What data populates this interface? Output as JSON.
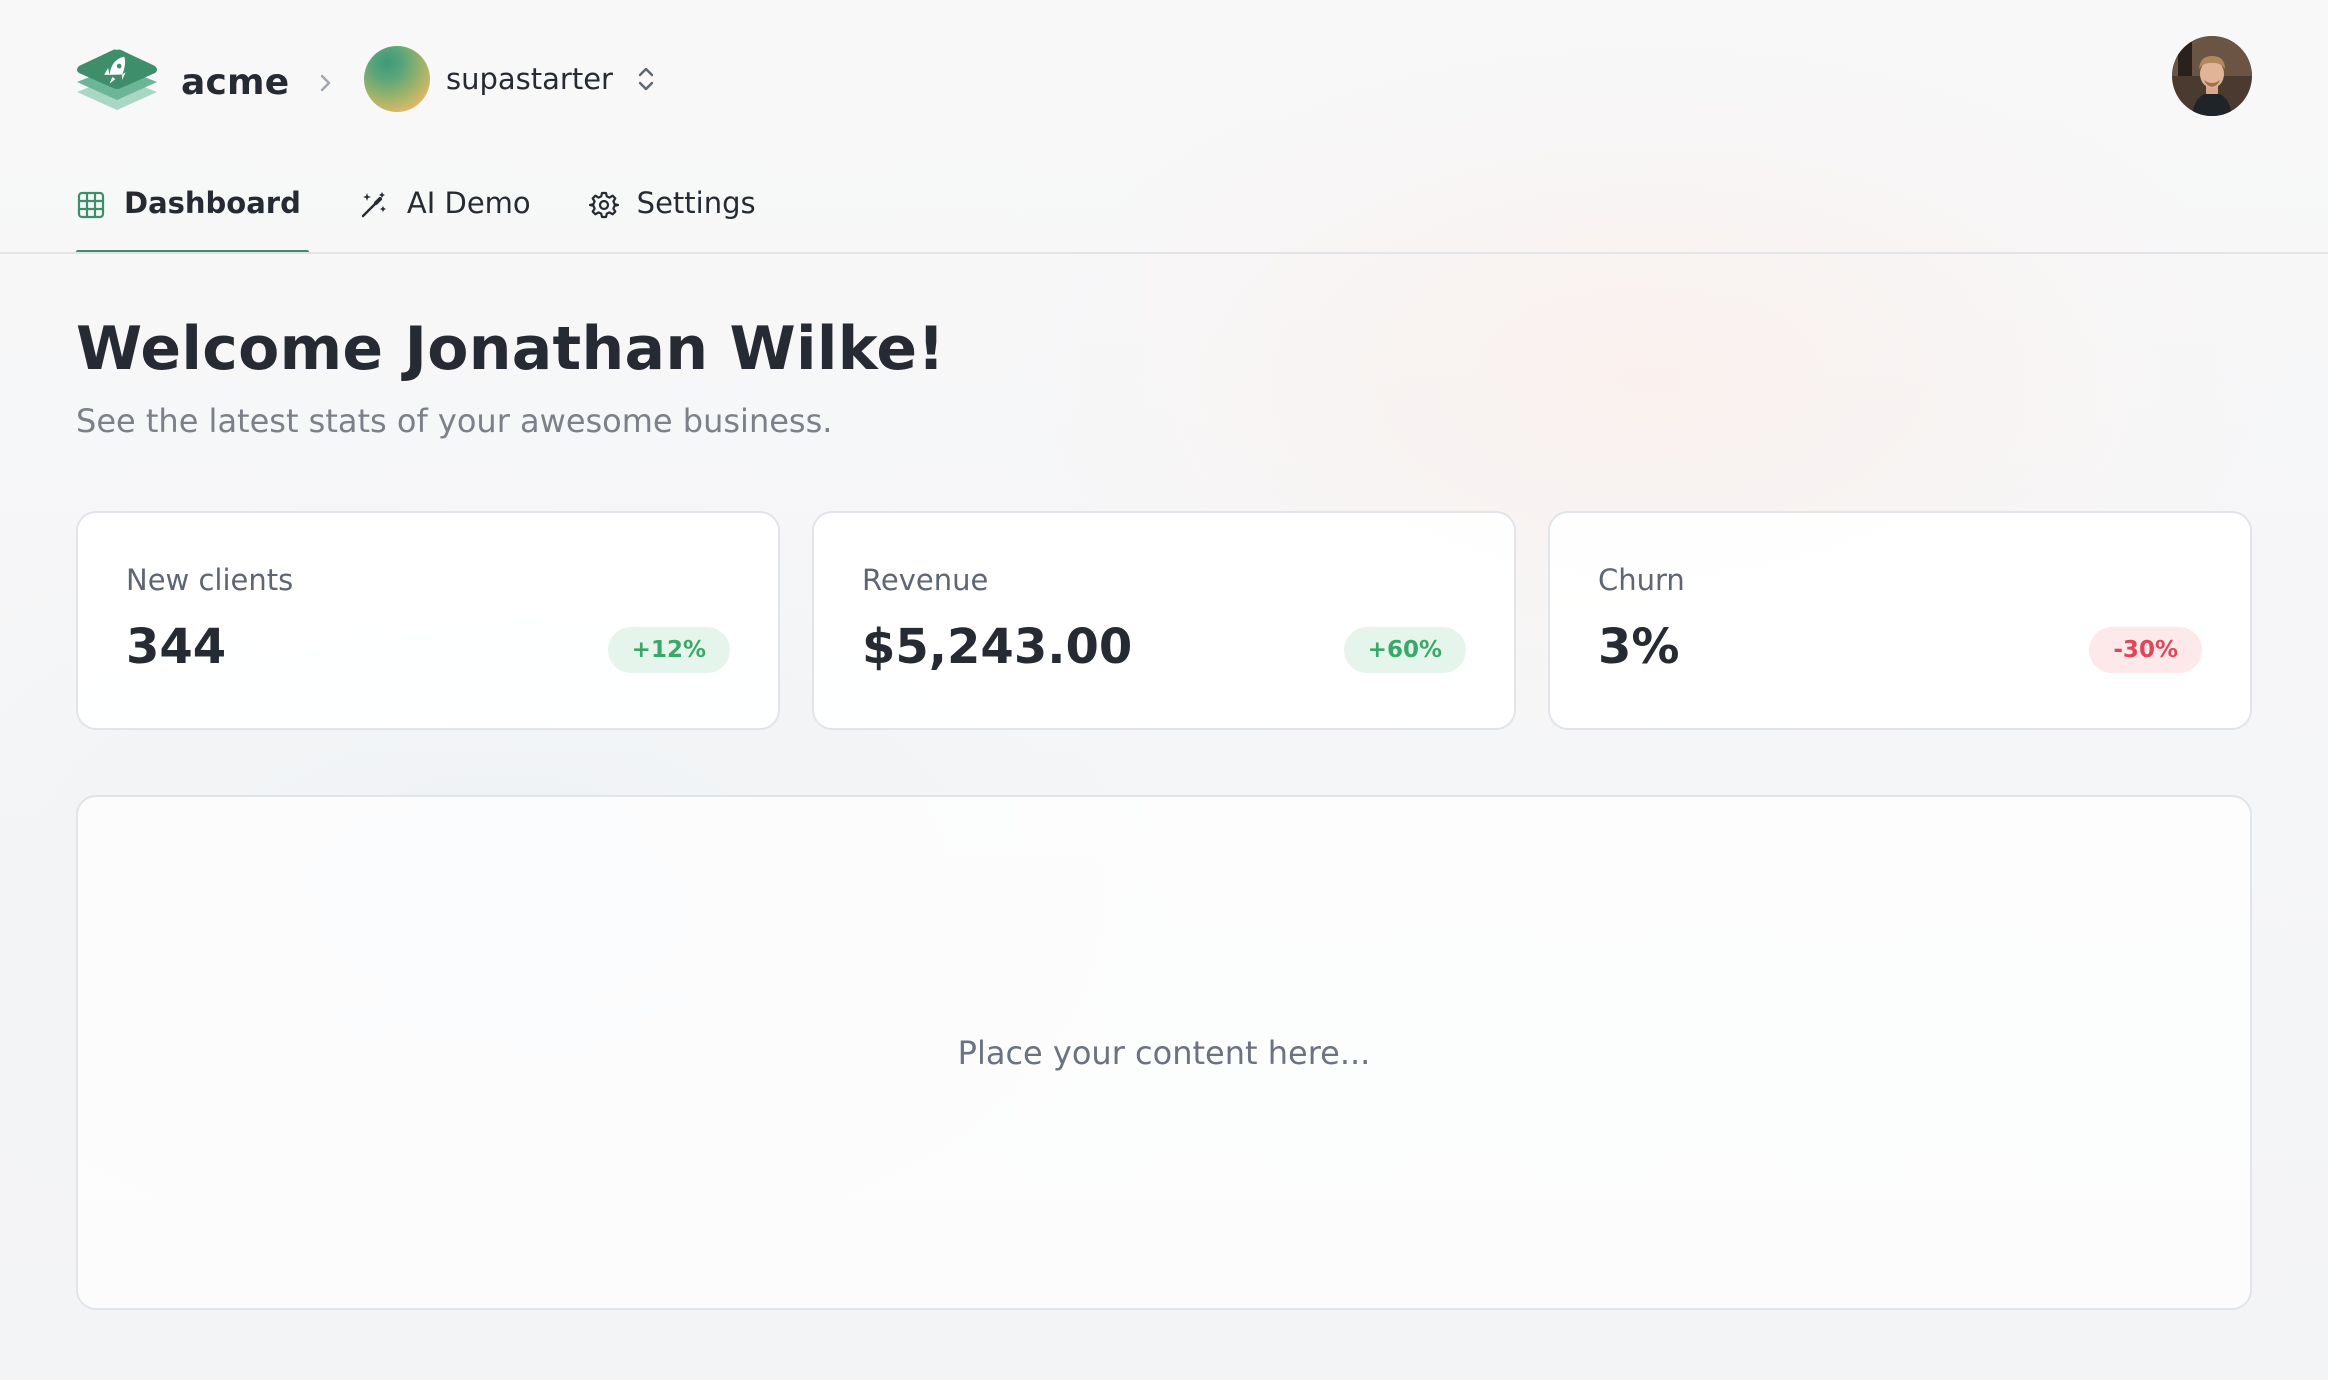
{
  "header": {
    "brand_name": "acme",
    "workspace_name": "supastarter",
    "icons": {
      "logo": "rocket-stack-logo",
      "breadcrumb_separator": "chevron-right-icon",
      "workspace_switcher": "chevron-up-down-icon",
      "user_avatar": "user-avatar-photo"
    }
  },
  "tabs": [
    {
      "label": "Dashboard",
      "icon": "grid-icon",
      "active": true
    },
    {
      "label": "AI Demo",
      "icon": "magic-wand-icon",
      "active": false
    },
    {
      "label": "Settings",
      "icon": "gear-icon",
      "active": false
    }
  ],
  "welcome": {
    "title": "Welcome Jonathan Wilke!",
    "subtitle": "See the latest stats of your awesome business."
  },
  "stats": [
    {
      "label": "New clients",
      "value": "344",
      "change": "+12%",
      "trend": "up"
    },
    {
      "label": "Revenue",
      "value": "$5,243.00",
      "change": "+60%",
      "trend": "up"
    },
    {
      "label": "Churn",
      "value": "3%",
      "change": "-30%",
      "trend": "down"
    }
  ],
  "content": {
    "placeholder": "Place your content here..."
  },
  "colors": {
    "accent": "#3e8e6c",
    "positive": "#3aa86a",
    "positive_bg": "#e6f5ec",
    "negative": "#e0455a",
    "negative_bg": "#fde8ea"
  }
}
